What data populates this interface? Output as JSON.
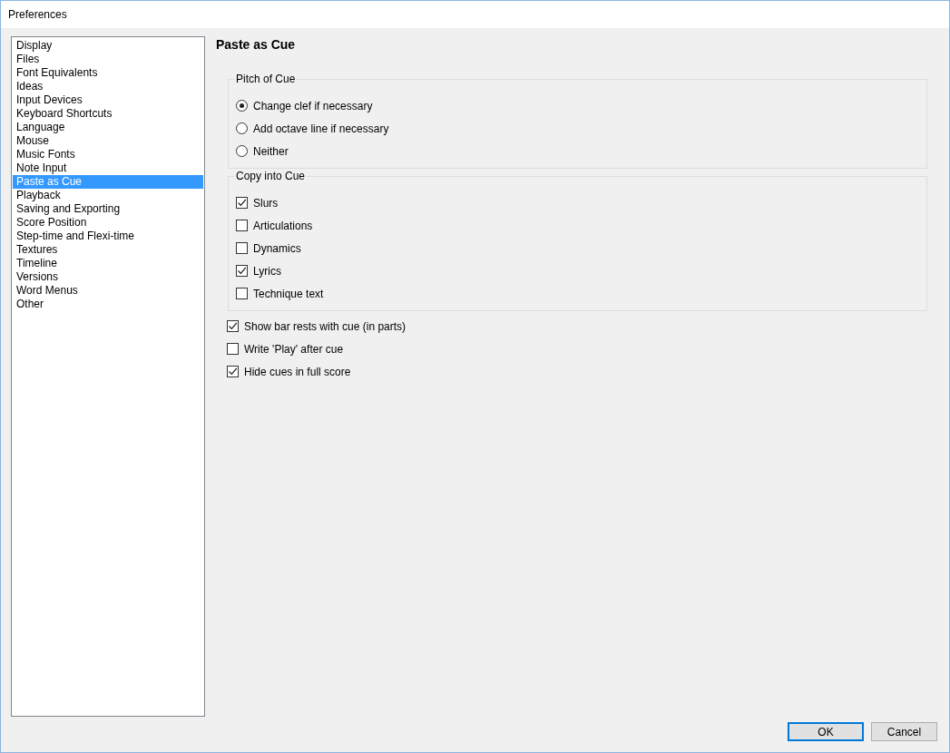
{
  "window": {
    "title": "Preferences"
  },
  "sidebar": {
    "items": [
      {
        "label": "Display",
        "selected": false
      },
      {
        "label": "Files",
        "selected": false
      },
      {
        "label": "Font Equivalents",
        "selected": false
      },
      {
        "label": "Ideas",
        "selected": false
      },
      {
        "label": "Input Devices",
        "selected": false
      },
      {
        "label": "Keyboard Shortcuts",
        "selected": false
      },
      {
        "label": "Language",
        "selected": false
      },
      {
        "label": "Mouse",
        "selected": false
      },
      {
        "label": "Music Fonts",
        "selected": false
      },
      {
        "label": "Note Input",
        "selected": false
      },
      {
        "label": "Paste as Cue",
        "selected": true
      },
      {
        "label": "Playback",
        "selected": false
      },
      {
        "label": "Saving and Exporting",
        "selected": false
      },
      {
        "label": "Score Position",
        "selected": false
      },
      {
        "label": "Step-time and Flexi-time",
        "selected": false
      },
      {
        "label": "Textures",
        "selected": false
      },
      {
        "label": "Timeline",
        "selected": false
      },
      {
        "label": "Versions",
        "selected": false
      },
      {
        "label": "Word Menus",
        "selected": false
      },
      {
        "label": "Other",
        "selected": false
      }
    ]
  },
  "page": {
    "title": "Paste as Cue",
    "groups": [
      {
        "title": "Pitch of Cue",
        "kind": "radio",
        "options": [
          {
            "label": "Change clef if necessary",
            "selected": true
          },
          {
            "label": "Add octave line if necessary",
            "selected": false
          },
          {
            "label": "Neither",
            "selected": false
          }
        ]
      },
      {
        "title": "Copy into Cue",
        "kind": "checkbox",
        "options": [
          {
            "label": "Slurs",
            "checked": true
          },
          {
            "label": "Articulations",
            "checked": false
          },
          {
            "label": "Dynamics",
            "checked": false
          },
          {
            "label": "Lyrics",
            "checked": true
          },
          {
            "label": "Technique text",
            "checked": false
          }
        ]
      }
    ],
    "options": [
      {
        "label": "Show bar rests with cue (in parts)",
        "checked": true
      },
      {
        "label": "Write 'Play' after cue",
        "checked": false
      },
      {
        "label": "Hide cues in full score",
        "checked": true
      }
    ]
  },
  "buttons": [
    {
      "label": "OK",
      "default": true
    },
    {
      "label": "Cancel",
      "default": false
    }
  ]
}
